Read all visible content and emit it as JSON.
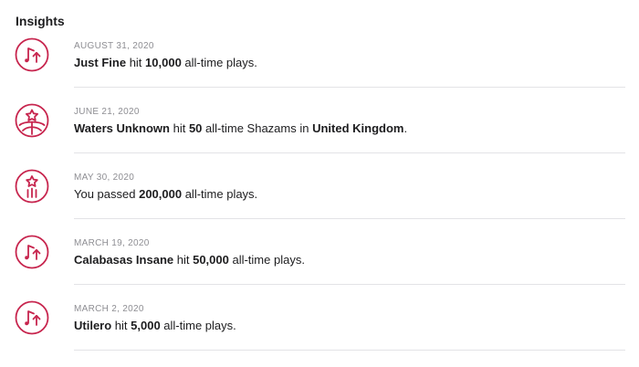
{
  "title": "Insights",
  "accent_color": "#c7254e",
  "items": [
    {
      "icon": "music-note-arrow-up-icon",
      "date": "AUGUST 31, 2020",
      "subject": "Just Fine",
      "connector": " hit ",
      "value": "10,000",
      "metric": " all-time plays.",
      "location_connector": "",
      "location": ""
    },
    {
      "icon": "star-globe-icon",
      "date": "JUNE 21, 2020",
      "subject": "Waters Unknown",
      "connector": " hit ",
      "value": "50",
      "metric": " all-time Shazams in ",
      "location": "United Kingdom",
      "end": "."
    },
    {
      "icon": "star-bars-icon",
      "date": "MAY 30, 2020",
      "subject": "",
      "connector": "You passed ",
      "value": "200,000",
      "metric": " all-time plays."
    },
    {
      "icon": "music-note-arrow-up-icon",
      "date": "MARCH 19, 2020",
      "subject": "Calabasas Insane",
      "connector": " hit ",
      "value": "50,000",
      "metric": " all-time plays."
    },
    {
      "icon": "music-note-arrow-up-icon",
      "date": "MARCH 2, 2020",
      "subject": "Utilero",
      "connector": " hit ",
      "value": "5,000",
      "metric": " all-time plays."
    }
  ]
}
